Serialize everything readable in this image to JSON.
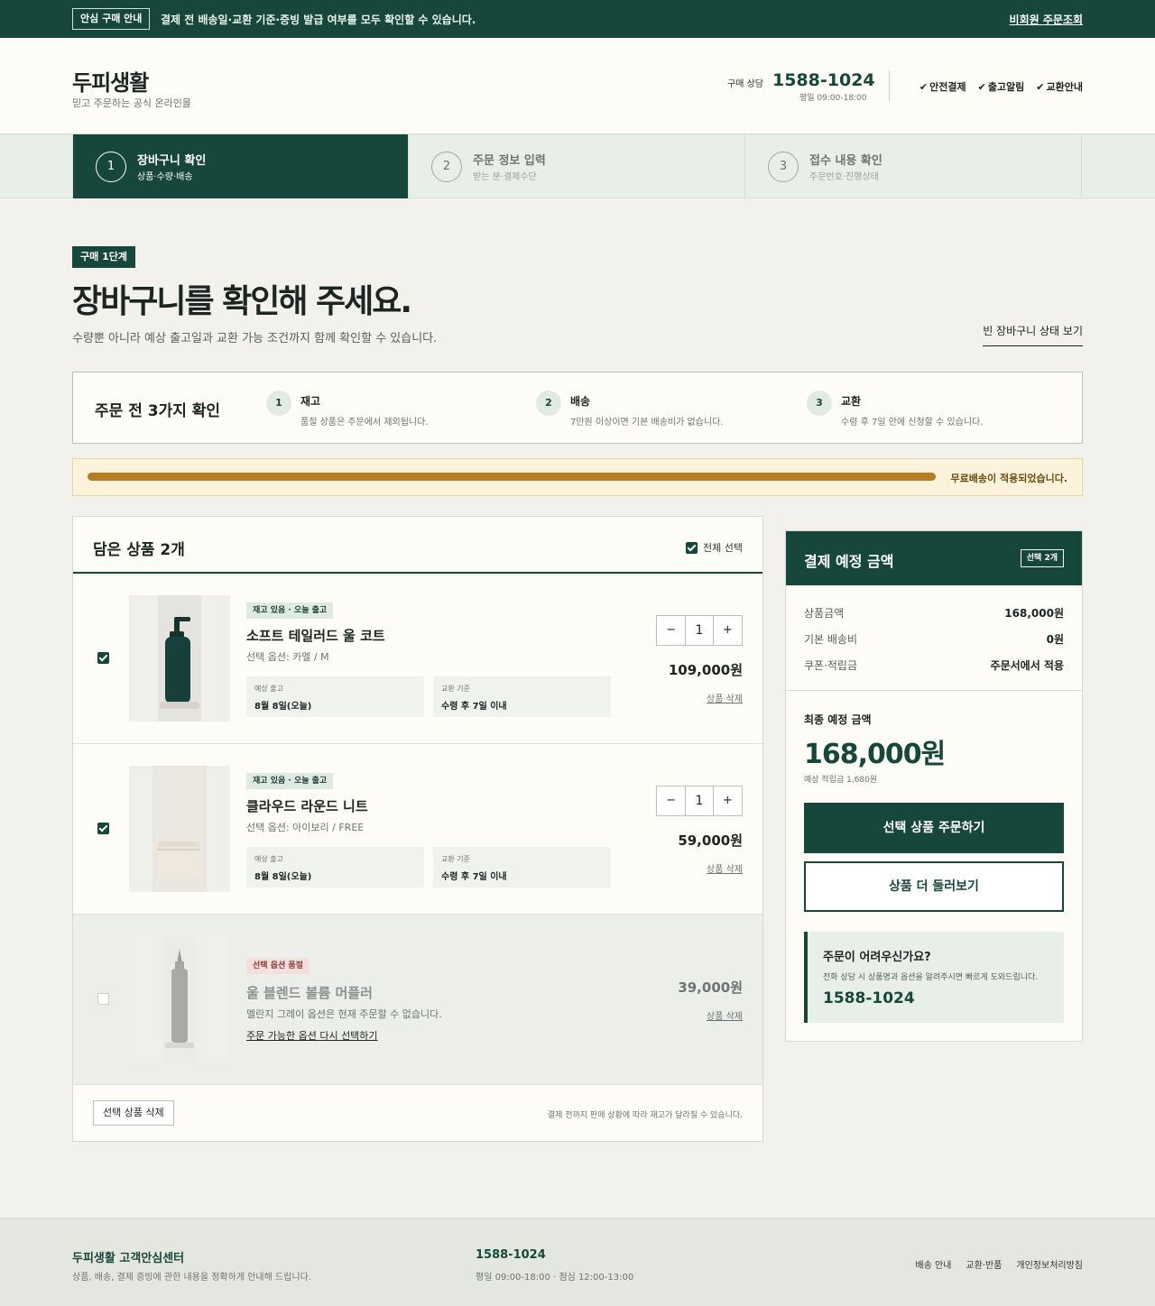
{
  "notice": {
    "badge": "안심 구매 안내",
    "text": "결제 전 배송일·교환 기준·증빙 발급 여부를 모두 확인할 수 있습니다.",
    "link": "비회원 주문조회"
  },
  "header": {
    "logo": "두피생활",
    "tagline": "믿고 주문하는 공식 온라인몰",
    "call_label": "구매 상담",
    "call_number": "1588-1024",
    "call_hours": "평일 09:00-18:00",
    "checks": [
      "안전결제",
      "출고알림",
      "교환안내"
    ]
  },
  "steps": [
    {
      "num": "1",
      "title": "장바구니 확인",
      "sub": "상품·수량·배송"
    },
    {
      "num": "2",
      "title": "주문 정보 입력",
      "sub": "받는 분·결제수단"
    },
    {
      "num": "3",
      "title": "접수 내용 확인",
      "sub": "주문번호·진행상태"
    }
  ],
  "hero": {
    "badge": "구매 1단계",
    "title": "장바구니를 확인해 주세요.",
    "lead": "수량뿐 아니라 예상 출고일과 교환 가능 조건까지 함께 확인할 수 있습니다.",
    "empty_link": "빈 장바구니 상태 보기"
  },
  "checklist": {
    "title": "주문 전 3가지 확인",
    "items": [
      {
        "num": "1",
        "title": "재고",
        "desc": "품절 상품은 주문에서 제외됩니다."
      },
      {
        "num": "2",
        "title": "배송",
        "desc": "7만원 이상이면 기본 배송비가 없습니다."
      },
      {
        "num": "3",
        "title": "교환",
        "desc": "수령 후 7일 안에 신청할 수 있습니다."
      }
    ]
  },
  "shipping_progress": {
    "fraction": 1.0,
    "text": "무료배송이 적용되었습니다."
  },
  "cart": {
    "title": "담은 상품 2개",
    "select_all": "전체 선택",
    "items": [
      {
        "tag": "재고 있음 · 오늘 출고",
        "name": "소프트 테일러드 울 코트",
        "option": "선택 옵션: 카멜 / M",
        "ship_label": "예상 출고",
        "ship_value": "8월 8일(오늘)",
        "exchange_label": "교환 기준",
        "exchange_value": "수령 후 7일 이내",
        "qty_minus": "−",
        "qty": "1",
        "qty_plus": "+",
        "price": "109,000원",
        "delete": "상품 삭제",
        "checked": true,
        "image": "green-pump-bottle"
      },
      {
        "tag": "재고 있음 · 오늘 출고",
        "name": "클라우드 라운드 니트",
        "option": "선택 옵션: 아이보리 / FREE",
        "ship_label": "예상 출고",
        "ship_value": "8월 8일(오늘)",
        "exchange_label": "교환 기준",
        "exchange_value": "수령 후 7일 이내",
        "qty_minus": "−",
        "qty": "1",
        "qty_plus": "+",
        "price": "59,000원",
        "delete": "상품 삭제",
        "checked": true,
        "image": "ivory-cream-jar"
      },
      {
        "tag": "선택 옵션 품절",
        "name": "울 블렌드 볼륨 머플러",
        "option": "멜란지 그레이 옵션은 현재 주문할 수 없습니다.",
        "relink": "주문 가능한 옵션 다시 선택하기",
        "price": "39,000원",
        "delete": "상품 삭제",
        "checked": false,
        "image": "grey-dropper-bottle"
      }
    ],
    "delete_selected": "선택 상품 삭제",
    "foot_note": "결제 전까지 판매 상황에 따라 재고가 달라질 수 있습니다."
  },
  "summary": {
    "title": "결제 예정 금액",
    "badge": "선택 2개",
    "rows": [
      {
        "label": "상품금액",
        "value": "168,000원"
      },
      {
        "label": "기본 배송비",
        "value": "0원"
      },
      {
        "label": "쿠폰·적립금",
        "value": "주문서에서 적용"
      }
    ],
    "final_label": "최종 예정 금액",
    "final_value": "168,000원",
    "points": "예상 적립금 1,680원",
    "order_button": "선택 상품 주문하기",
    "more_button": "상품 더 둘러보기",
    "help_title": "주문이 어려우신가요?",
    "help_desc": "전화 상담 시 상품명과 옵션을 알려주시면 빠르게 도와드립니다.",
    "help_number": "1588-1024"
  },
  "footer": {
    "title": "두피생활 고객안심센터",
    "desc": "상품, 배송, 결제 증빙에 관한 내용을 정확하게 안내해 드립니다.",
    "number": "1588-1024",
    "hours": "평일 09:00-18:00 · 점심 12:00-13:00",
    "links": [
      "배송 안내",
      "교환·반품",
      "개인정보처리방침"
    ]
  },
  "colors": {
    "brand": "#17473a",
    "progress": "#b57e24",
    "background": "#f3f1ec"
  }
}
